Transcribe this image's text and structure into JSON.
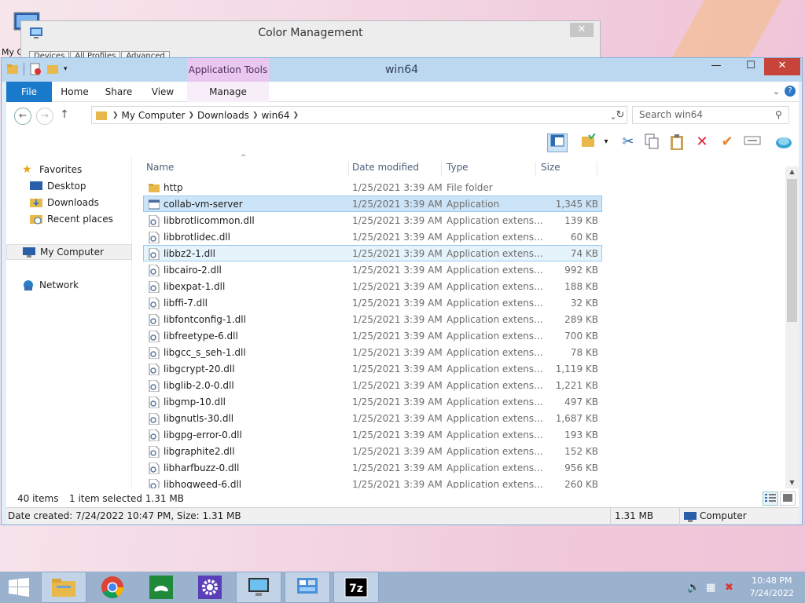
{
  "desktop": {
    "icon_label": "My C"
  },
  "color_mgmt": {
    "title": "Color Management",
    "close": "✕",
    "tabs": [
      "Devices",
      "All Profiles",
      "Advanced"
    ]
  },
  "explorer": {
    "title": "win64",
    "app_tools": "Application Tools",
    "ribbon": {
      "file": "File",
      "home": "Home",
      "share": "Share",
      "view": "View",
      "manage": "Manage",
      "help": "?"
    },
    "address": {
      "crumbs": [
        "My Computer",
        "Downloads",
        "win64"
      ]
    },
    "search": {
      "placeholder": "Search win64"
    },
    "nav": {
      "favorites": "Favorites",
      "desktop": "Desktop",
      "downloads": "Downloads",
      "recent": "Recent places",
      "computer": "My Computer",
      "network": "Network"
    },
    "columns": {
      "name": "Name",
      "date": "Date modified",
      "type": "Type",
      "size": "Size"
    },
    "files": [
      {
        "name": "http",
        "date": "1/25/2021 3:39 AM",
        "type": "File folder",
        "size": "",
        "kind": "folder"
      },
      {
        "name": "collab-vm-server",
        "date": "1/25/2021 3:39 AM",
        "type": "Application",
        "size": "1,345 KB",
        "kind": "app"
      },
      {
        "name": "libbrotlicommon.dll",
        "date": "1/25/2021 3:39 AM",
        "type": "Application extens...",
        "size": "139 KB",
        "kind": "dll"
      },
      {
        "name": "libbrotlidec.dll",
        "date": "1/25/2021 3:39 AM",
        "type": "Application extens...",
        "size": "60 KB",
        "kind": "dll"
      },
      {
        "name": "libbz2-1.dll",
        "date": "1/25/2021 3:39 AM",
        "type": "Application extens...",
        "size": "74 KB",
        "kind": "dll"
      },
      {
        "name": "libcairo-2.dll",
        "date": "1/25/2021 3:39 AM",
        "type": "Application extens...",
        "size": "992 KB",
        "kind": "dll"
      },
      {
        "name": "libexpat-1.dll",
        "date": "1/25/2021 3:39 AM",
        "type": "Application extens...",
        "size": "188 KB",
        "kind": "dll"
      },
      {
        "name": "libffi-7.dll",
        "date": "1/25/2021 3:39 AM",
        "type": "Application extens...",
        "size": "32 KB",
        "kind": "dll"
      },
      {
        "name": "libfontconfig-1.dll",
        "date": "1/25/2021 3:39 AM",
        "type": "Application extens...",
        "size": "289 KB",
        "kind": "dll"
      },
      {
        "name": "libfreetype-6.dll",
        "date": "1/25/2021 3:39 AM",
        "type": "Application extens...",
        "size": "700 KB",
        "kind": "dll"
      },
      {
        "name": "libgcc_s_seh-1.dll",
        "date": "1/25/2021 3:39 AM",
        "type": "Application extens...",
        "size": "78 KB",
        "kind": "dll"
      },
      {
        "name": "libgcrypt-20.dll",
        "date": "1/25/2021 3:39 AM",
        "type": "Application extens...",
        "size": "1,119 KB",
        "kind": "dll"
      },
      {
        "name": "libglib-2.0-0.dll",
        "date": "1/25/2021 3:39 AM",
        "type": "Application extens...",
        "size": "1,221 KB",
        "kind": "dll"
      },
      {
        "name": "libgmp-10.dll",
        "date": "1/25/2021 3:39 AM",
        "type": "Application extens...",
        "size": "497 KB",
        "kind": "dll"
      },
      {
        "name": "libgnutls-30.dll",
        "date": "1/25/2021 3:39 AM",
        "type": "Application extens...",
        "size": "1,687 KB",
        "kind": "dll"
      },
      {
        "name": "libgpg-error-0.dll",
        "date": "1/25/2021 3:39 AM",
        "type": "Application extens...",
        "size": "193 KB",
        "kind": "dll"
      },
      {
        "name": "libgraphite2.dll",
        "date": "1/25/2021 3:39 AM",
        "type": "Application extens...",
        "size": "152 KB",
        "kind": "dll"
      },
      {
        "name": "libharfbuzz-0.dll",
        "date": "1/25/2021 3:39 AM",
        "type": "Application extens...",
        "size": "956 KB",
        "kind": "dll"
      },
      {
        "name": "libhogweed-6.dll",
        "date": "1/25/2021 3:39 AM",
        "type": "Application extens...",
        "size": "260 KB",
        "kind": "dll"
      }
    ],
    "status": {
      "count": "40 items",
      "selected": "1 item selected  1.31 MB"
    },
    "details_bar": {
      "info": "Date created: 7/24/2022 10:47 PM, Size: 1.31 MB",
      "size": "1.31 MB",
      "location": "Computer"
    }
  },
  "taskbar": {
    "time": "10:48 PM",
    "date": "7/24/2022",
    "apps": [
      "file-explorer",
      "chrome",
      "games",
      "settings",
      "color-management",
      "control-panel",
      "7-zip"
    ]
  },
  "colors": {
    "accent": "#1979ca",
    "selection": "#cce4f7",
    "close": "#c7443a",
    "taskbar": "#9bb2cf"
  }
}
